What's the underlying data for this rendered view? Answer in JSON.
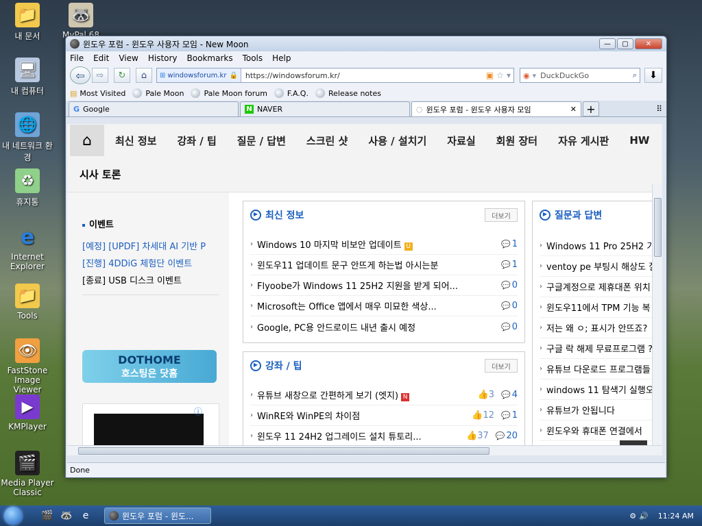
{
  "desktop": {
    "icons": [
      {
        "label": "내 문서",
        "glyph": "📁"
      },
      {
        "label": "MyPal 68",
        "glyph": "🦝"
      },
      {
        "label": "내 컴퓨터",
        "glyph": "🖥"
      },
      {
        "label": "내 네트워크 환경",
        "glyph": "🌐"
      },
      {
        "label": "휴지통",
        "glyph": "♻"
      },
      {
        "label": "Internet Explorer",
        "glyph": "e"
      },
      {
        "label": "Tools",
        "glyph": "📁"
      },
      {
        "label": "FastStone Image Viewer",
        "glyph": "👁"
      },
      {
        "label": "KMPlayer",
        "glyph": "▶"
      },
      {
        "label": "Media Player Classic",
        "glyph": "🎬"
      }
    ]
  },
  "window": {
    "title": "윈도우 포럼 - 윈도우 사용자 모임 - New Moon",
    "menu": [
      "File",
      "Edit",
      "View",
      "History",
      "Bookmarks",
      "Tools",
      "Help"
    ],
    "site_identity": "windowsforum.kr",
    "url": "https://windowsforum.kr/",
    "search_placeholder": "DuckDuckGo",
    "bookmarks": [
      "Most Visited",
      "Pale Moon",
      "Pale Moon forum",
      "F.A.Q.",
      "Release notes"
    ],
    "tabs": [
      {
        "label": "Google",
        "icon": "google-icon"
      },
      {
        "label": "NAVER",
        "icon": "naver-icon"
      },
      {
        "label": "윈도우 포럼 - 윈도우 사용자 모임",
        "icon": "loading-icon",
        "active": true
      }
    ],
    "status": "Done"
  },
  "site": {
    "nav": [
      "최신 정보",
      "강좌 / 팁",
      "질문 / 답변",
      "스크린 샷",
      "사용 / 설치기",
      "자료실",
      "회원 장터",
      "자유 게시판",
      "HW"
    ],
    "nav_row2": "시사 토론",
    "events": {
      "title": "이벤트",
      "items": [
        {
          "text": "[예정] [UPDF] 차세대 AI 기반 P",
          "style": "blue"
        },
        {
          "text": "[진행] 4DDiG 체험단 이벤트",
          "style": "blue"
        },
        {
          "text": "[종료] USB 디스크 이벤트",
          "style": "dark"
        }
      ]
    },
    "banner": {
      "line1": "DOTHOME",
      "line2": "호스팅은 닷홈"
    },
    "more_label": "더보기",
    "latest": {
      "title": "최신 정보",
      "rows": [
        {
          "text": "Windows 10 마지막 비보안 업데이트",
          "tag": "U",
          "comments": "1"
        },
        {
          "text": "윈도우11 업데이트 문구 안뜨게 하는법 아시는분",
          "comments": "1"
        },
        {
          "text": "Flyoobe가 Windows 11 25H2 지원을 받게 되어...",
          "comments": "0"
        },
        {
          "text": "Microsoft는 Office 앱에서 매우 미묘한 색상...",
          "comments": "0"
        },
        {
          "text": "Google, PC용 안드로이드 내년 출시 예정",
          "comments": "0"
        }
      ]
    },
    "tips": {
      "title": "강좌 / 팁",
      "rows": [
        {
          "text": "유튜브 새창으로 간편하게 보기 (엣지)",
          "tag": "N",
          "likes": "3",
          "comments": "4"
        },
        {
          "text": "WinRE와 WinPE의 차이점",
          "likes": "12",
          "comments": "1"
        },
        {
          "text": "윈도우 11 24H2 업그레이드 설치 튜토리...",
          "likes": "37",
          "comments": "20"
        }
      ]
    },
    "qa": {
      "title": "질문과 답변",
      "rows": [
        "Windows 11 Pro 25H2 가",
        "ventoy pe 부팅시 해상도 질",
        "구글계정으로 제휴대폰 위치",
        "윈도우11에서 TPM 기능 복",
        "저는 왜 ㅇ; 표시가 안뜨죠?",
        "구글 락 해제 무료프로그램 ?",
        "유튜브 다운로드 프로그램들",
        "windows 11 탐색기 실행오",
        "유튜브가 안됩니다",
        "윈도우와 휴대폰 연결에서"
      ]
    }
  },
  "taskbar": {
    "task_label": "윈도우 포럼 - 윈도...",
    "clock": "11:24 AM"
  }
}
